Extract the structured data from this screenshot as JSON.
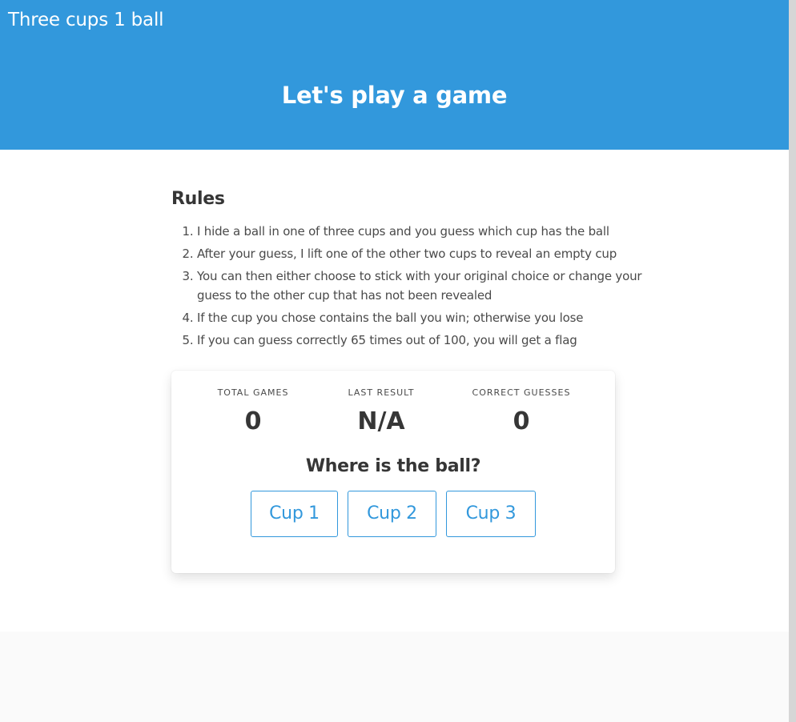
{
  "navbar": {
    "brand": "Three cups 1 ball"
  },
  "hero": {
    "title": "Let's play a game"
  },
  "rules": {
    "title": "Rules",
    "items": [
      "I hide a ball in one of three cups and you guess which cup has the ball",
      "After your guess, I lift one of the other two cups to reveal an empty cup",
      "You can then either choose to stick with your original choice or change your guess to the other cup that has not been revealed",
      "If the cup you chose contains the ball you win; otherwise you lose",
      "If you can guess correctly 65 times out of 100, you will get a flag"
    ]
  },
  "stats": {
    "total_games": {
      "heading": "TOTAL GAMES",
      "value": "0"
    },
    "last_result": {
      "heading": "LAST RESULT",
      "value": "N/A"
    },
    "correct_guesses": {
      "heading": "CORRECT GUESSES",
      "value": "0"
    }
  },
  "game": {
    "question": "Where is the ball?",
    "cups": [
      "Cup 1",
      "Cup 2",
      "Cup 3"
    ]
  },
  "colors": {
    "accent": "#3298dc",
    "text": "#363636",
    "footer_bg": "#fafafa"
  }
}
